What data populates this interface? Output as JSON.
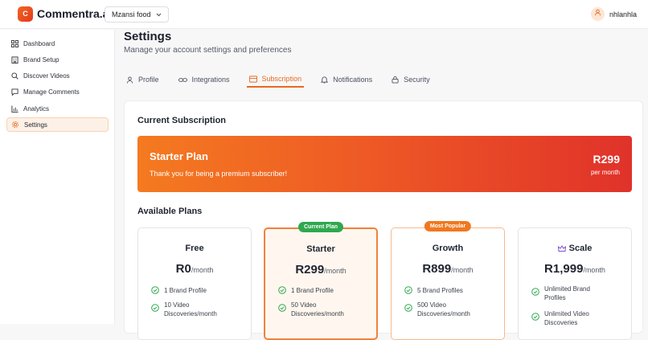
{
  "app": {
    "logo_letter": "C",
    "name": "Commentra.ai"
  },
  "header": {
    "brand_select": "Mzansi food",
    "user_initial": "ꝏ",
    "user_name": "nhlanhla"
  },
  "sidebar": {
    "items": [
      {
        "label": "Dashboard",
        "icon": "grid-icon"
      },
      {
        "label": "Brand Setup",
        "icon": "building-icon"
      },
      {
        "label": "Discover Videos",
        "icon": "search-icon"
      },
      {
        "label": "Manage Comments",
        "icon": "comment-icon"
      },
      {
        "label": "Analytics",
        "icon": "bar-chart-icon"
      },
      {
        "label": "Settings",
        "icon": "gear-icon",
        "active": true
      }
    ]
  },
  "page": {
    "title": "Settings",
    "subtitle": "Manage your account settings and preferences"
  },
  "tabs": [
    {
      "label": "Profile",
      "icon": "user-icon"
    },
    {
      "label": "Integrations",
      "icon": "link-icon"
    },
    {
      "label": "Subscription",
      "icon": "card-icon",
      "active": true
    },
    {
      "label": "Notifications",
      "icon": "bell-icon"
    },
    {
      "label": "Security",
      "icon": "lock-icon"
    }
  ],
  "subscription": {
    "section_title": "Current Subscription",
    "plan_name": "Starter Plan",
    "thanks": "Thank you for being a premium subscriber!",
    "price": "R299",
    "period": "per month"
  },
  "available": {
    "section_title": "Available Plans",
    "plans": [
      {
        "name": "Free",
        "price": "R0",
        "per": "/month",
        "badge": "",
        "features": [
          "1 Brand Profile",
          "10 Video Discoveries/month"
        ]
      },
      {
        "name": "Starter",
        "price": "R299",
        "per": "/month",
        "badge": "Current Plan",
        "features": [
          "1 Brand Profile",
          "50 Video Discoveries/month"
        ]
      },
      {
        "name": "Growth",
        "price": "R899",
        "per": "/month",
        "badge": "Most Popular",
        "features": [
          "5 Brand Profiles",
          "500 Video Discoveries/month"
        ]
      },
      {
        "name": "Scale",
        "price": "R1,999",
        "per": "/month",
        "badge": "",
        "icon": "crown-icon",
        "features": [
          "Unlimited Brand Profiles",
          "Unlimited Video Discoveries"
        ]
      }
    ]
  },
  "colors": {
    "accent": "#e86a1f",
    "current_badge": "#2fa84f",
    "popular_badge": "#f0781f",
    "check": "#2fa84f"
  }
}
